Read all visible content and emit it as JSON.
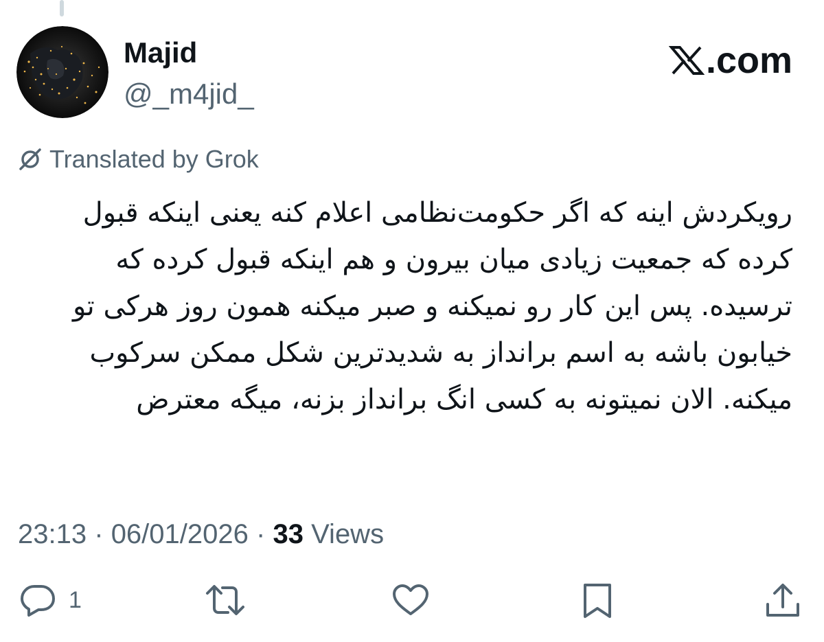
{
  "brand": {
    "logo_icon": "x-logo-icon",
    "domain_text": ".com"
  },
  "author": {
    "name": "Majid",
    "handle": "@_m4jid_"
  },
  "translation": {
    "label": "Translated by Grok",
    "icon": "translate-icon"
  },
  "tweet": {
    "text": "رویکردش اینه که اگر حکومت‌نظامی اعلام کنه یعنی اینکه قبول کرده که جمعیت زیادی میان بیرون و هم اینکه قبول کرده که ترسیده. پس این کار رو نمیکنه و صبر میکنه همون روز هرکی تو خیابون باشه به اسم برانداز به شدیدترین شکل ممکن سرکوب میکنه. الان نمیتونه به کسی انگ برانداز بزنه، میگه معترض"
  },
  "meta": {
    "time": "23:13",
    "separator": "·",
    "date": "06/01/2026",
    "views_count": "33",
    "views_label": "Views"
  },
  "actions": {
    "reply_count": "1",
    "icons": [
      "reply-icon",
      "retweet-icon",
      "like-icon",
      "bookmark-icon",
      "share-icon"
    ]
  },
  "colors": {
    "text_primary": "#0f1419",
    "text_secondary": "#536471",
    "thread_line": "#cfd9de"
  }
}
